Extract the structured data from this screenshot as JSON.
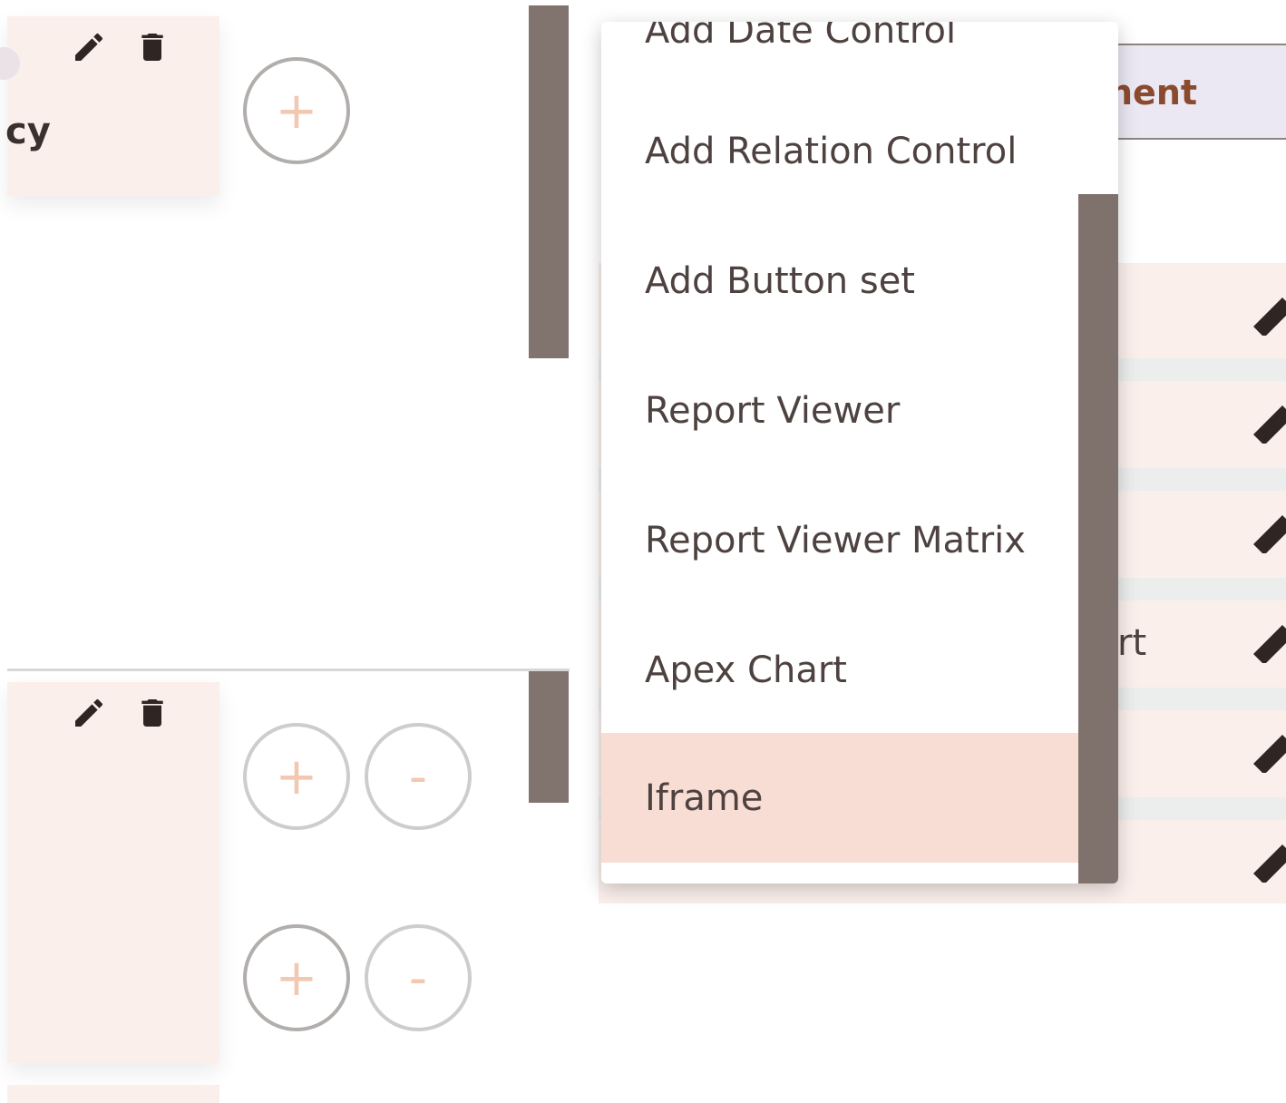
{
  "left_panel": {
    "card1_text": "cy",
    "card1_tools": {
      "edit_icon": "pencil-icon",
      "delete_icon": "trash-icon"
    },
    "card2_tools": {
      "edit_icon": "pencil-icon",
      "delete_icon": "trash-icon"
    },
    "add_symbol": "+",
    "remove_symbol": "-"
  },
  "right_panel": {
    "header_fragment": "nent",
    "row_fragment": "rt"
  },
  "menu": {
    "items": [
      {
        "label": "Add Date Control"
      },
      {
        "label": "Add Relation Control"
      },
      {
        "label": "Add Button set"
      },
      {
        "label": "Report Viewer"
      },
      {
        "label": "Report Viewer Matrix"
      },
      {
        "label": "Apex Chart"
      },
      {
        "label": "Iframe"
      }
    ],
    "selected_index": 6
  },
  "colors": {
    "accent_plus": "#f3c8b1",
    "selected_item_bg": "#f8ddd4",
    "splitter": "#81736e",
    "card_bg": "#fbefeb"
  }
}
